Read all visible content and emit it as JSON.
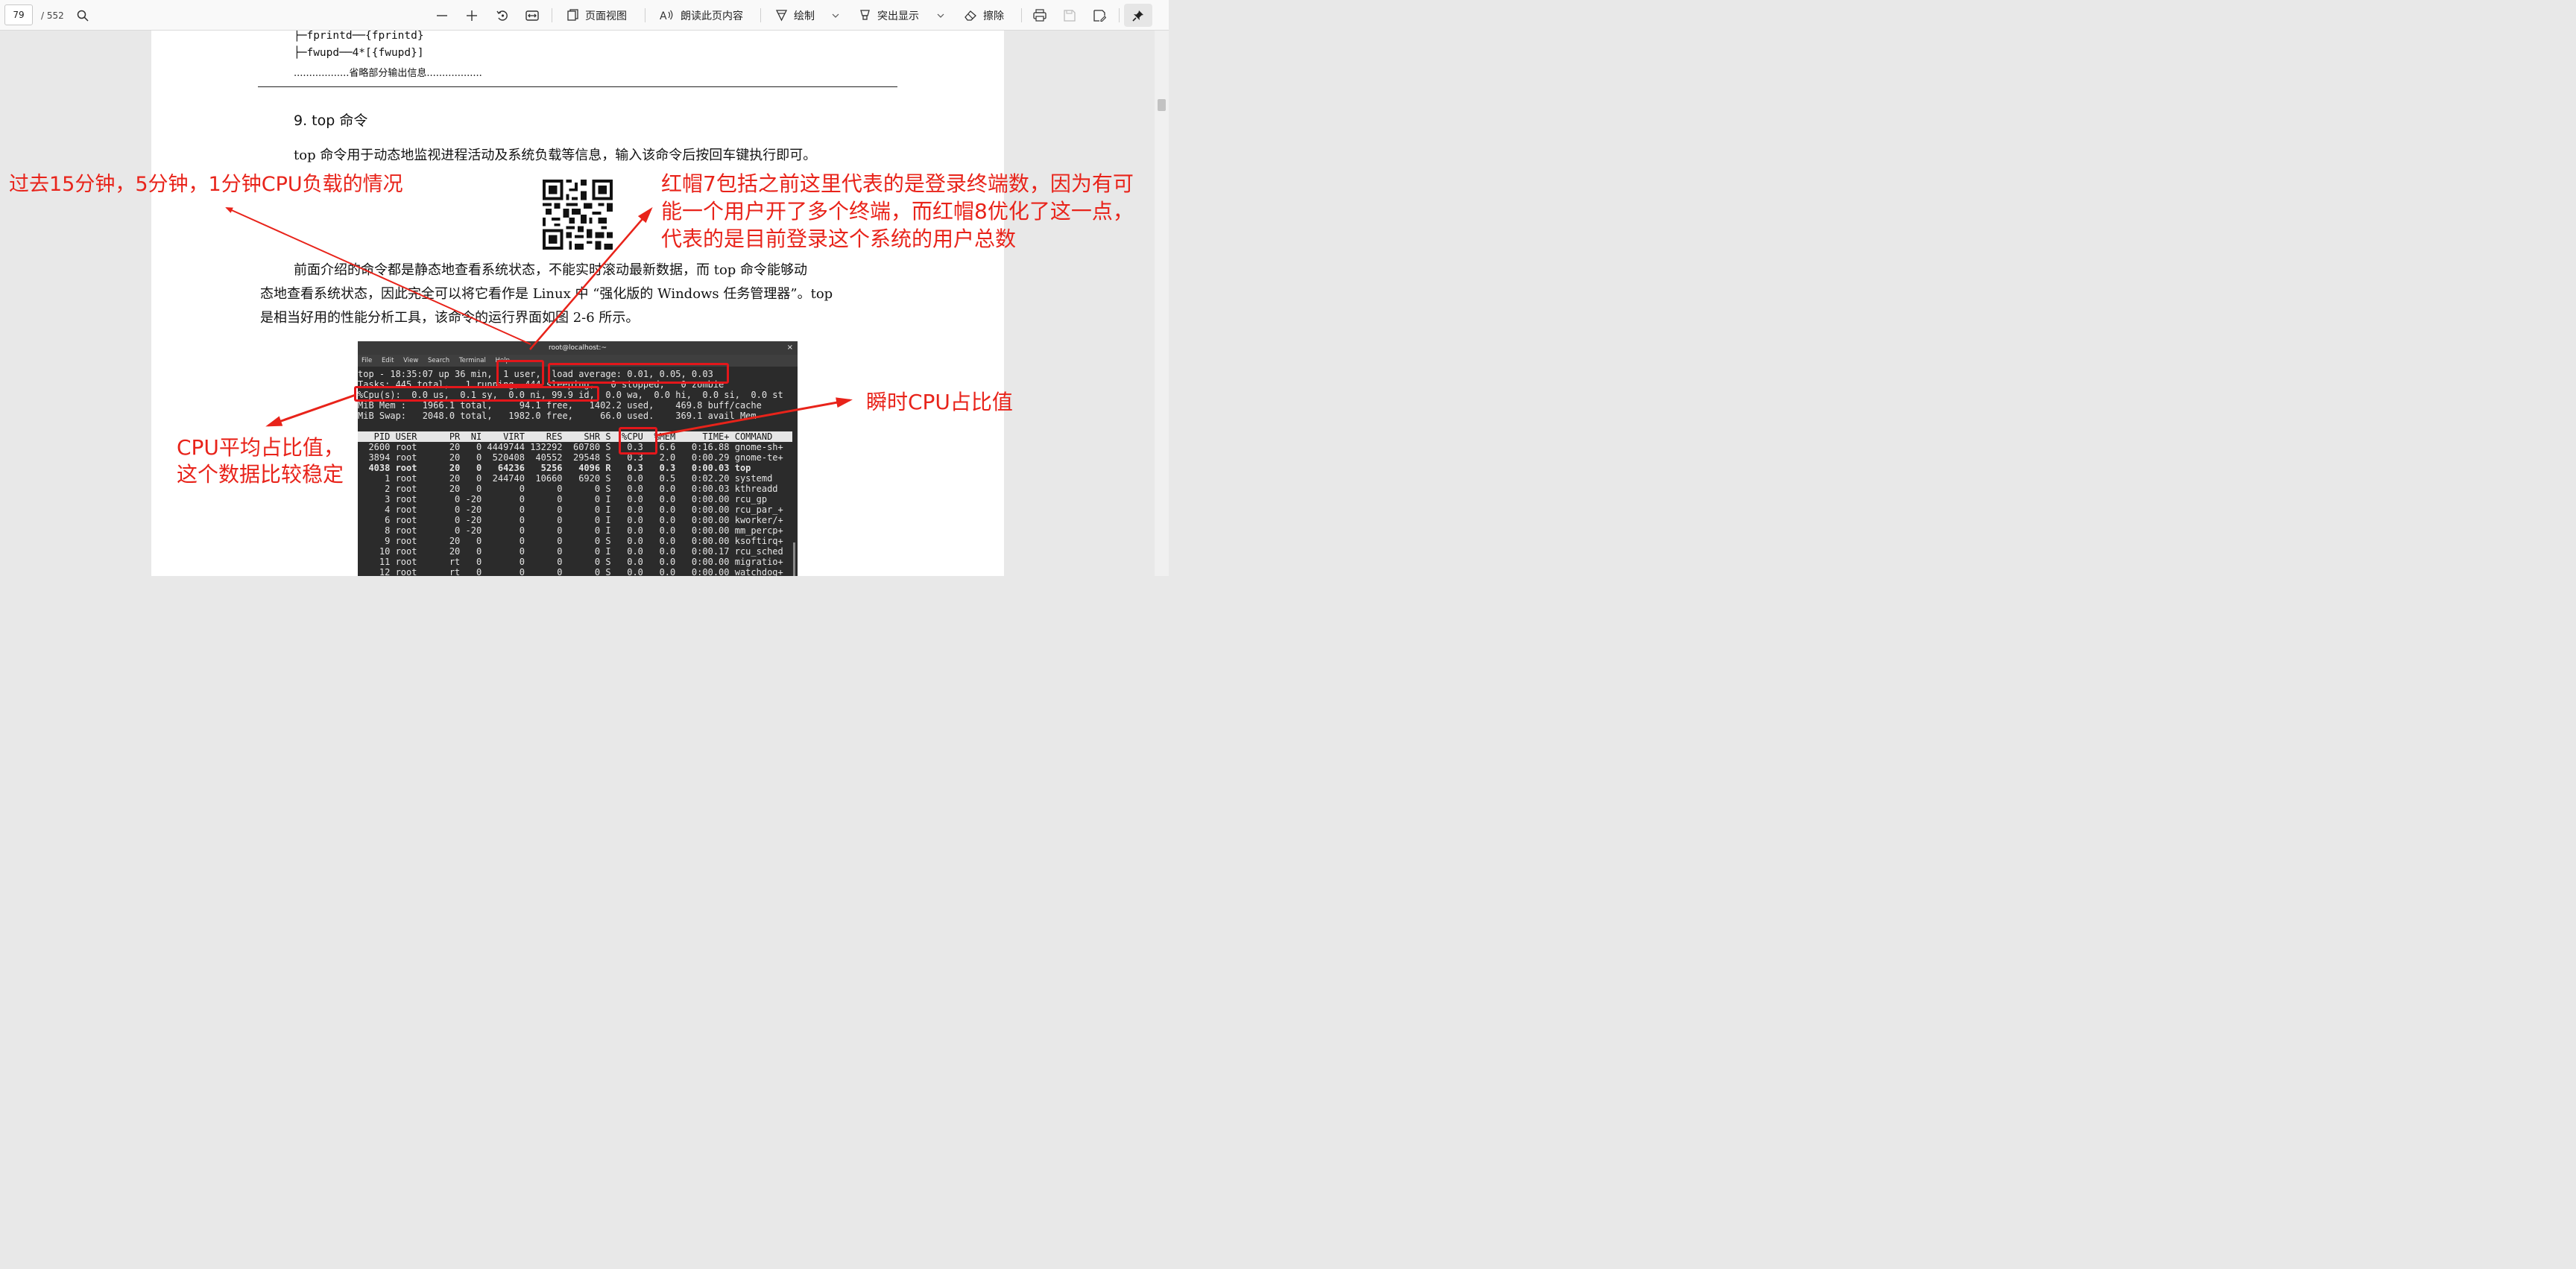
{
  "toolbar": {
    "page_number": "79",
    "page_total": "/ 552",
    "page_view": "页面视图",
    "read_aloud": "朗读此页内容",
    "draw": "绘制",
    "highlight": "突出显示",
    "erase": "擦除"
  },
  "document": {
    "tree_line_1": "├─fprintd──{fprintd}",
    "tree_line_2": "├─fwupd──4*[{fwupd}]",
    "omitted": "..................省略部分输出信息..................",
    "section_heading": "9.  top 命令",
    "para1": "top 命令用于动态地监视进程活动及系统负载等信息，输入该命令后按回车键执行即可。",
    "para2_l1": "前面介绍的命令都是静态地查看系统状态，不能实时滚动最新数据，而 top 命令能够动",
    "para2_l2": "态地查看系统状态，因此完全可以将它看作是 Linux 中 “强化版的 Windows 任务管理器”。top",
    "para2_l3": "是相当好用的性能分析工具，该命令的运行界面如图 2-6 所示。"
  },
  "terminal": {
    "title": "root@localhost:~",
    "close": "×",
    "menu": [
      "File",
      "Edit",
      "View",
      "Search",
      "Terminal",
      "Help"
    ],
    "summary": [
      "top - 18:35:07 up 36 min,  1 user,  load average: 0.01, 0.05, 0.03",
      "Tasks: 445 total,   1 running, 444 sleeping,   0 stopped,   0 zombie",
      "%Cpu(s):  0.0 us,  0.1 sy,  0.0 ni, 99.9 id,  0.0 wa,  0.0 hi,  0.0 si,  0.0 st",
      "MiB Mem :   1966.1 total,     94.1 free,   1402.2 used,    469.8 buff/cache",
      "MiB Swap:   2048.0 total,   1982.0 free,     66.0 used.    369.1 avail Mem"
    ],
    "header": "   PID USER      PR  NI    VIRT    RES    SHR S  %CPU  %MEM     TIME+ COMMAND",
    "rows": [
      "  2600 root      20   0 4449744 132292  60780 S   0.3   6.6   0:16.88 gnome-sh+",
      "  3894 root      20   0  520408  40552  29548 S   0.3   2.0   0:00.29 gnome-te+",
      "  4038 root      20   0   64236   5256   4096 R   0.3   0.3   0:00.03 top",
      "     1 root      20   0  244740  10660   6920 S   0.0   0.5   0:02.20 systemd",
      "     2 root      20   0       0      0      0 S   0.0   0.0   0:00.03 kthreadd",
      "     3 root       0 -20       0      0      0 I   0.0   0.0   0:00.00 rcu_gp",
      "     4 root       0 -20       0      0      0 I   0.0   0.0   0:00.00 rcu_par_+",
      "     6 root       0 -20       0      0      0 I   0.0   0.0   0:00.00 kworker/+",
      "     8 root       0 -20       0      0      0 I   0.0   0.0   0:00.00 mm_percp+",
      "     9 root      20   0       0      0      0 S   0.0   0.0   0:00.00 ksoftirq+",
      "    10 root      20   0       0      0      0 I   0.0   0.0   0:00.17 rcu_sched",
      "    11 root      rt   0       0      0      0 S   0.0   0.0   0:00.00 migratio+",
      "    12 root      rt   0       0      0      0 S   0.0   0.0   0:00.00 watchdog+"
    ]
  },
  "annotations": {
    "load": "过去15分钟，5分钟，1分钟CPU负载的情况",
    "users_l1": "红帽7包括之前这里代表的是登录终端数，因为有可",
    "users_l2": "能一个用户开了多个终端，而红帽8优化了这一点，",
    "users_l3": "代表的是目前登录这个系统的用户总数",
    "cpu_avg_l1": "CPU平均占比值，",
    "cpu_avg_l2": "这个数据比较稳定",
    "cpu_instant": "瞬时CPU占比值"
  },
  "colors": {
    "annotation_red": "#e8231a",
    "terminal_bg": "#2b2b2b"
  }
}
